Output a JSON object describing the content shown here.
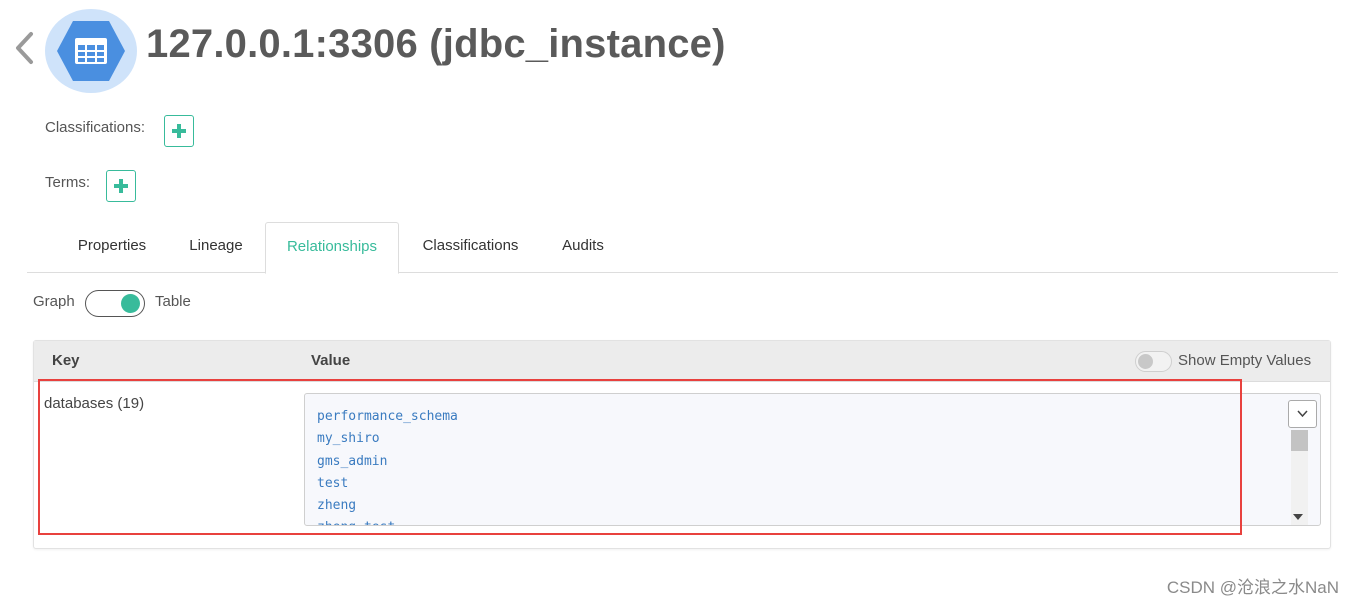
{
  "header": {
    "title": "127.0.0.1:3306 (jdbc_instance)",
    "back_icon": "chevron-left-icon",
    "entity_icon": "table-icon",
    "entity_icon_color": "#4a8fe0"
  },
  "meta": {
    "classifications_label": "Classifications:",
    "terms_label": "Terms:",
    "add_icon": "plus-icon",
    "accent_color": "#38bb9b"
  },
  "tabs": [
    {
      "label": "Properties",
      "active": false
    },
    {
      "label": "Lineage",
      "active": false
    },
    {
      "label": "Relationships",
      "active": true
    },
    {
      "label": "Classifications",
      "active": false
    },
    {
      "label": "Audits",
      "active": false
    }
  ],
  "view_switch": {
    "left_label": "Graph",
    "right_label": "Table",
    "selected": "Table"
  },
  "relationships_table": {
    "key_header": "Key",
    "value_header": "Value",
    "show_empty_label": "Show Empty Values",
    "show_empty_enabled": false,
    "rows": [
      {
        "key": "databases (19)",
        "values": [
          "performance_schema",
          "my_shiro",
          "gms_admin",
          "test",
          "zheng",
          "zheng_test"
        ]
      }
    ]
  },
  "annotation_color": "#e8413e",
  "watermark": "CSDN @沧浪之水NaN"
}
